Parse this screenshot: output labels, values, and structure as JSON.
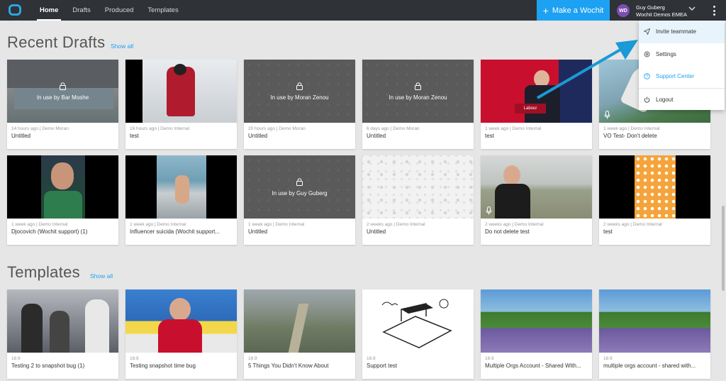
{
  "topbar": {
    "nav": [
      "Home",
      "Drafts",
      "Produced",
      "Templates"
    ],
    "make_button": "Make a Wochit",
    "avatar_initials": "WD",
    "user_name": "Guy Guberg",
    "org_name": "Wochit Demos EMEA"
  },
  "drafts": {
    "title": "Recent Drafts",
    "show_all": "Show all",
    "cards": [
      {
        "meta": "14 hours ago | Demo Moran",
        "title": "Untitled",
        "lock": "In use by Bar Moshe"
      },
      {
        "meta": "16 hours ago | Demo Internal",
        "title": "test",
        "lock": ""
      },
      {
        "meta": "20 hours ago | Demo Moran",
        "title": "Untitled",
        "lock": "In use by Moran Zenou"
      },
      {
        "meta": "6 days ago | Demo Moran",
        "title": "Untitled",
        "lock": "In use by Moran Zenou"
      },
      {
        "meta": "1 week ago | Demo Internal",
        "title": "test",
        "lock": ""
      },
      {
        "meta": "1 week ago | Demo Internal",
        "title": "VO Test- Don't delete",
        "lock": ""
      },
      {
        "meta": "1 week ago | Demo Internal",
        "title": "Djocovich (Wochit support) (1)",
        "lock": ""
      },
      {
        "meta": "1 week ago | Demo Internal",
        "title": "Influencer suicida (Wochit support...",
        "lock": ""
      },
      {
        "meta": "1 week ago | Demo Internal",
        "title": "Untitled",
        "lock": "In use by Guy Guberg"
      },
      {
        "meta": "2 weeks ago | Demo Internal",
        "title": "Untitled",
        "lock": ""
      },
      {
        "meta": "2 weeks ago | Demo Internal",
        "title": "Do not delete test",
        "lock": ""
      },
      {
        "meta": "2 weeks ago | Demo Internal",
        "title": "test",
        "lock": ""
      }
    ]
  },
  "templates": {
    "title": "Templates",
    "show_all": "Show all",
    "cards": [
      {
        "meta": "16:9",
        "title": "Testing 2 to snapshot bug (1)"
      },
      {
        "meta": "16:9",
        "title": "Testing snapshot time bug"
      },
      {
        "meta": "16:9",
        "title": "5 Things You Didn't Know About"
      },
      {
        "meta": "16:9",
        "title": "Support test"
      },
      {
        "meta": "16:9",
        "title": "Multiple Orgs Account - Shared With..."
      },
      {
        "meta": "16:9",
        "title": "multiple orgs account - shared with..."
      }
    ]
  },
  "user_menu": {
    "items": [
      "Invite teammate",
      "Settings",
      "Support Center",
      "Logout"
    ]
  },
  "thumb_text": {
    "labour_sign": "Labour"
  },
  "colors": {
    "accent": "#1da1f2",
    "topbar": "#2f3237",
    "arrow": "#1a9ad6"
  }
}
